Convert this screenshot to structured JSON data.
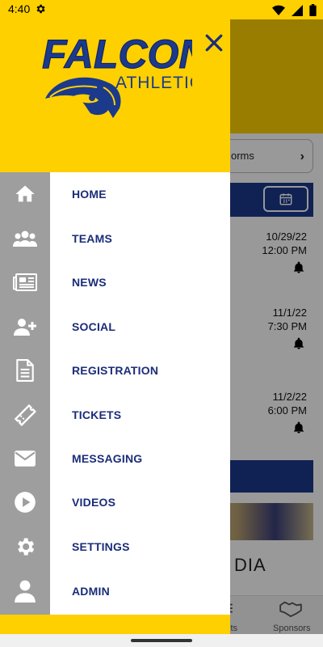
{
  "status_bar": {
    "time": "4:40"
  },
  "background": {
    "forms_text": "orms",
    "events": [
      {
        "date": "10/29/22",
        "time": "12:00 PM"
      },
      {
        "date": "11/1/22",
        "time": "7:30 PM"
      },
      {
        "date": "11/2/22",
        "time": "6:00 PM"
      }
    ],
    "media_text": "DIA",
    "bottom_nav": {
      "results_partial": "lts",
      "sponsors": "Sponsors"
    }
  },
  "drawer": {
    "logo": {
      "title": "FALCON",
      "subtitle": "ATHLETICS"
    },
    "menu": [
      {
        "label": "HOME",
        "icon": "home-icon"
      },
      {
        "label": "TEAMS",
        "icon": "teams-icon"
      },
      {
        "label": "NEWS",
        "icon": "news-icon"
      },
      {
        "label": "SOCIAL",
        "icon": "social-icon"
      },
      {
        "label": "REGISTRATION",
        "icon": "registration-icon"
      },
      {
        "label": "TICKETS",
        "icon": "tickets-icon"
      },
      {
        "label": "MESSAGING",
        "icon": "messaging-icon"
      },
      {
        "label": "VIDEOS",
        "icon": "videos-icon"
      },
      {
        "label": "SETTINGS",
        "icon": "settings-icon"
      },
      {
        "label": "ADMIN",
        "icon": "admin-icon"
      }
    ]
  },
  "colors": {
    "brand_yellow": "#ffd000",
    "brand_navy": "#1b2d7a",
    "rail_gray": "#9e9e9e"
  }
}
